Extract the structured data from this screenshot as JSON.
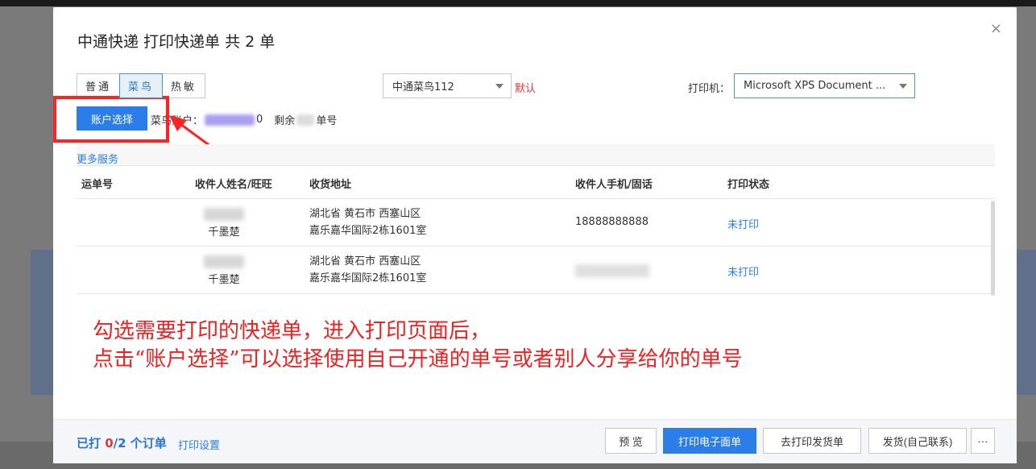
{
  "modal": {
    "title": "中通快递 打印快递单 共 2 单",
    "close": "×"
  },
  "tabs": [
    {
      "label": "普通"
    },
    {
      "label": "菜鸟",
      "active": true
    },
    {
      "label": "热敏"
    }
  ],
  "company_select": {
    "value": "中通菜鸟112"
  },
  "default_link": "默认",
  "printer": {
    "label": "打印机：",
    "value": "Microsoft XPS Document Writer"
  },
  "account": {
    "button": "账户选择",
    "prefix": "菜鸟账户：",
    "suffix_digit": "0",
    "remaining": "剩余",
    "unit": "单号"
  },
  "more_services": "更多服务",
  "table": {
    "headers": [
      "运单号",
      "收件人姓名/旺旺",
      "收货地址",
      "收件人手机/固话",
      "打印状态"
    ],
    "rows": [
      {
        "name": "千墨楚",
        "addr1": "湖北省 黄石市 西塞山区",
        "addr2": "嘉乐嘉华国际2栋1601室",
        "phone": "18888888888",
        "status": "未打印"
      },
      {
        "name": "千墨楚",
        "addr1": "湖北省 黄石市 西塞山区",
        "addr2": "嘉乐嘉华国际2栋1601室",
        "phone": "",
        "status": "未打印"
      }
    ]
  },
  "annotation": {
    "line1": "勾选需要打印的快递单，进入打印页面后，",
    "line2": "点击“账户选择”可以选择使用自己开通的单号或者别人分享给你的单号"
  },
  "footer": {
    "printed_prefix": "已打 ",
    "printed_count": "0",
    "printed_total": "/2 个订单",
    "settings": "打印设置",
    "buttons": {
      "preview": "预 览",
      "print_waybill": "打印电子面单",
      "print_invoice": "去打印发货单",
      "ship": "发货(自己联系)",
      "more": "···"
    }
  },
  "colors": {
    "accent": "#2b7de9",
    "highlight": "#ff2222",
    "annotation": "#ee2222"
  }
}
